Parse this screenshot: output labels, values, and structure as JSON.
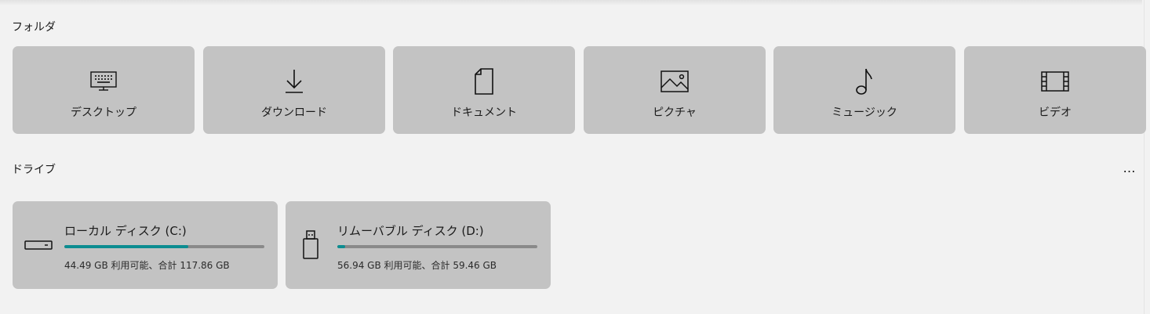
{
  "sections": {
    "folders_label": "フォルダ",
    "drives_label": "ドライブ",
    "more_label": "…"
  },
  "folders": [
    {
      "label": "デスクトップ",
      "icon": "desktop-icon"
    },
    {
      "label": "ダウンロード",
      "icon": "download-icon"
    },
    {
      "label": "ドキュメント",
      "icon": "document-icon"
    },
    {
      "label": "ピクチャ",
      "icon": "picture-icon"
    },
    {
      "label": "ミュージック",
      "icon": "music-icon"
    },
    {
      "label": "ビデオ",
      "icon": "video-icon"
    }
  ],
  "drives": [
    {
      "name": "ローカル ディスク (C:)",
      "capacity_text": "44.49 GB 利用可能、合計 117.86 GB",
      "icon": "hard-drive-icon",
      "used_fraction": 0.62,
      "bar_color": "#0c8d91"
    },
    {
      "name": "リムーバブル ディスク (D:)",
      "capacity_text": "56.94 GB 利用可能、合計 59.46 GB",
      "icon": "usb-drive-icon",
      "used_fraction": 0.04,
      "bar_color": "#0c8d91"
    }
  ]
}
